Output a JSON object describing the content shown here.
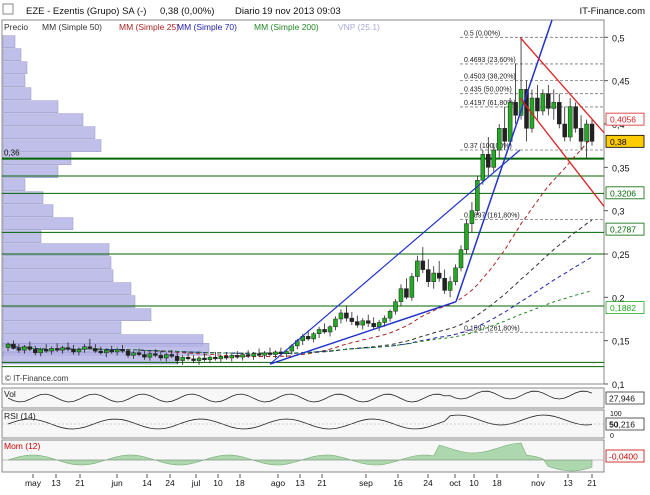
{
  "header": {
    "title": "EZE - Ezentis (Grupo) SA (-)",
    "price": "0,38 (0,00%)",
    "period": "Diario",
    "timestamp": "19 nov 2013 09:03",
    "brand": "IT-Finance.com"
  },
  "legend": [
    {
      "label": "Precio",
      "color": "#333333"
    },
    {
      "label": "MM (Simple 50)",
      "color": "#333333"
    },
    {
      "label": "MM (Simple 25)",
      "color": "#aa2222"
    },
    {
      "label": "MM (Simple 70)",
      "color": "#2222aa"
    },
    {
      "label": "MM (Simple 200)",
      "color": "#228822"
    },
    {
      "label": "VNP (25.1)",
      "color": "#aaaadd"
    }
  ],
  "copyright": "© IT-Finance.com",
  "colors": {
    "up": "#22aa22",
    "down": "#222222",
    "support": "#006600",
    "trend": "#2233cc",
    "resistance": "#dd2222",
    "fib": "#777777",
    "volume_profile": "#b4b4e6"
  },
  "chart_data": {
    "type": "candlestick",
    "ylim": [
      0.1,
      0.52
    ],
    "y_ticks": [
      {
        "value": 0.5,
        "label": "0,5"
      },
      {
        "value": 0.45,
        "label": "0,45"
      },
      {
        "value": 0.4,
        "label": "0,4"
      },
      {
        "value": 0.35,
        "label": "0,35"
      },
      {
        "value": 0.3,
        "label": "0,3"
      },
      {
        "value": 0.25,
        "label": "0,25"
      },
      {
        "value": 0.2,
        "label": "0,2"
      },
      {
        "value": 0.15,
        "label": "0,15"
      },
      {
        "value": 0.1,
        "label": "0,1"
      }
    ],
    "x_labels": [
      "may",
      "13",
      "21",
      "jun",
      "14",
      "24",
      "jul",
      "10",
      "18",
      "ago",
      "13",
      "21",
      "sep",
      "16",
      "24",
      "oct",
      "10",
      "18",
      "nov",
      "13",
      "21"
    ],
    "price_tags": [
      {
        "value": 0.4056,
        "label": "0,4056",
        "color": "#dd2222"
      },
      {
        "value": 0.38,
        "label": "0,38",
        "color": "#000000",
        "highlight": true
      },
      {
        "value": 0.3206,
        "label": "0,3206",
        "color": "#006600"
      },
      {
        "value": 0.2787,
        "label": "0,2787",
        "color": "#006600"
      },
      {
        "value": 0.1882,
        "label": "0,1882",
        "color": "#22aa22"
      }
    ],
    "support_levels": [
      0.36,
      0.34,
      0.32,
      0.275,
      0.25,
      0.19,
      0.125,
      0.12
    ],
    "left_level_label": {
      "value": 0.36,
      "label": "0,36"
    },
    "fibonacci": [
      {
        "value": 0.5,
        "label": "0.5 (0,00%)"
      },
      {
        "value": 0.4693,
        "label": "0.4693 (23,60%)"
      },
      {
        "value": 0.4503,
        "label": "0.4503 (38,20%)"
      },
      {
        "value": 0.435,
        "label": "0.435 (50,00%)"
      },
      {
        "value": 0.4197,
        "label": "0.4197 (61,80%)"
      },
      {
        "value": 0.37,
        "label": "0.37 (100,00%)"
      },
      {
        "value": 0.2897,
        "label": "0.2897 (161,80%)"
      },
      {
        "value": 0.1597,
        "label": "0.1597 (261,80%)"
      }
    ],
    "volume_profile": [
      {
        "y": 0.495,
        "w": 12
      },
      {
        "y": 0.48,
        "w": 18
      },
      {
        "y": 0.465,
        "w": 24
      },
      {
        "y": 0.45,
        "w": 22
      },
      {
        "y": 0.435,
        "w": 28
      },
      {
        "y": 0.42,
        "w": 55
      },
      {
        "y": 0.405,
        "w": 80
      },
      {
        "y": 0.39,
        "w": 92
      },
      {
        "y": 0.375,
        "w": 98
      },
      {
        "y": 0.36,
        "w": 68
      },
      {
        "y": 0.345,
        "w": 55
      },
      {
        "y": 0.33,
        "w": 22
      },
      {
        "y": 0.315,
        "w": 40
      },
      {
        "y": 0.3,
        "w": 50
      },
      {
        "y": 0.285,
        "w": 70
      },
      {
        "y": 0.27,
        "w": 38
      },
      {
        "y": 0.255,
        "w": 106
      },
      {
        "y": 0.24,
        "w": 108
      },
      {
        "y": 0.225,
        "w": 110
      },
      {
        "y": 0.21,
        "w": 128
      },
      {
        "y": 0.195,
        "w": 132
      },
      {
        "y": 0.18,
        "w": 148
      },
      {
        "y": 0.165,
        "w": 118
      },
      {
        "y": 0.15,
        "w": 200
      },
      {
        "y": 0.14,
        "w": 206
      },
      {
        "y": 0.13,
        "w": 175
      }
    ],
    "candles": [
      {
        "o": 0.142,
        "h": 0.148,
        "l": 0.138,
        "c": 0.146
      },
      {
        "o": 0.146,
        "h": 0.15,
        "l": 0.14,
        "c": 0.141
      },
      {
        "o": 0.141,
        "h": 0.146,
        "l": 0.136,
        "c": 0.139
      },
      {
        "o": 0.139,
        "h": 0.145,
        "l": 0.135,
        "c": 0.143
      },
      {
        "o": 0.143,
        "h": 0.149,
        "l": 0.138,
        "c": 0.14
      },
      {
        "o": 0.14,
        "h": 0.144,
        "l": 0.133,
        "c": 0.136
      },
      {
        "o": 0.136,
        "h": 0.142,
        "l": 0.132,
        "c": 0.14
      },
      {
        "o": 0.14,
        "h": 0.146,
        "l": 0.136,
        "c": 0.138
      },
      {
        "o": 0.138,
        "h": 0.143,
        "l": 0.134,
        "c": 0.141
      },
      {
        "o": 0.141,
        "h": 0.147,
        "l": 0.137,
        "c": 0.139
      },
      {
        "o": 0.139,
        "h": 0.144,
        "l": 0.135,
        "c": 0.142
      },
      {
        "o": 0.142,
        "h": 0.148,
        "l": 0.138,
        "c": 0.14
      },
      {
        "o": 0.14,
        "h": 0.145,
        "l": 0.134,
        "c": 0.137
      },
      {
        "o": 0.137,
        "h": 0.142,
        "l": 0.133,
        "c": 0.14
      },
      {
        "o": 0.14,
        "h": 0.146,
        "l": 0.136,
        "c": 0.143
      },
      {
        "o": 0.143,
        "h": 0.152,
        "l": 0.139,
        "c": 0.141
      },
      {
        "o": 0.141,
        "h": 0.146,
        "l": 0.136,
        "c": 0.138
      },
      {
        "o": 0.138,
        "h": 0.143,
        "l": 0.134,
        "c": 0.136
      },
      {
        "o": 0.136,
        "h": 0.141,
        "l": 0.131,
        "c": 0.139
      },
      {
        "o": 0.139,
        "h": 0.144,
        "l": 0.135,
        "c": 0.137
      },
      {
        "o": 0.137,
        "h": 0.142,
        "l": 0.133,
        "c": 0.14
      },
      {
        "o": 0.14,
        "h": 0.145,
        "l": 0.136,
        "c": 0.138
      },
      {
        "o": 0.138,
        "h": 0.14,
        "l": 0.13,
        "c": 0.133
      },
      {
        "o": 0.133,
        "h": 0.138,
        "l": 0.129,
        "c": 0.136
      },
      {
        "o": 0.136,
        "h": 0.141,
        "l": 0.132,
        "c": 0.134
      },
      {
        "o": 0.134,
        "h": 0.139,
        "l": 0.128,
        "c": 0.131
      },
      {
        "o": 0.131,
        "h": 0.137,
        "l": 0.127,
        "c": 0.135
      },
      {
        "o": 0.135,
        "h": 0.14,
        "l": 0.131,
        "c": 0.133
      },
      {
        "o": 0.133,
        "h": 0.138,
        "l": 0.127,
        "c": 0.13
      },
      {
        "o": 0.13,
        "h": 0.136,
        "l": 0.126,
        "c": 0.134
      },
      {
        "o": 0.134,
        "h": 0.139,
        "l": 0.13,
        "c": 0.132
      },
      {
        "o": 0.132,
        "h": 0.136,
        "l": 0.123,
        "c": 0.127
      },
      {
        "o": 0.127,
        "h": 0.133,
        "l": 0.122,
        "c": 0.131
      },
      {
        "o": 0.131,
        "h": 0.136,
        "l": 0.127,
        "c": 0.129
      },
      {
        "o": 0.129,
        "h": 0.133,
        "l": 0.124,
        "c": 0.127
      },
      {
        "o": 0.127,
        "h": 0.132,
        "l": 0.122,
        "c": 0.13
      },
      {
        "o": 0.13,
        "h": 0.135,
        "l": 0.126,
        "c": 0.128
      },
      {
        "o": 0.128,
        "h": 0.133,
        "l": 0.124,
        "c": 0.131
      },
      {
        "o": 0.131,
        "h": 0.137,
        "l": 0.127,
        "c": 0.129
      },
      {
        "o": 0.129,
        "h": 0.134,
        "l": 0.125,
        "c": 0.132
      },
      {
        "o": 0.132,
        "h": 0.137,
        "l": 0.128,
        "c": 0.13
      },
      {
        "o": 0.13,
        "h": 0.135,
        "l": 0.126,
        "c": 0.133
      },
      {
        "o": 0.133,
        "h": 0.138,
        "l": 0.129,
        "c": 0.131
      },
      {
        "o": 0.131,
        "h": 0.136,
        "l": 0.127,
        "c": 0.134
      },
      {
        "o": 0.134,
        "h": 0.139,
        "l": 0.13,
        "c": 0.132
      },
      {
        "o": 0.132,
        "h": 0.137,
        "l": 0.128,
        "c": 0.135
      },
      {
        "o": 0.135,
        "h": 0.141,
        "l": 0.131,
        "c": 0.133
      },
      {
        "o": 0.133,
        "h": 0.138,
        "l": 0.129,
        "c": 0.136
      },
      {
        "o": 0.136,
        "h": 0.142,
        "l": 0.132,
        "c": 0.134
      },
      {
        "o": 0.134,
        "h": 0.139,
        "l": 0.13,
        "c": 0.137
      },
      {
        "o": 0.137,
        "h": 0.142,
        "l": 0.133,
        "c": 0.135
      },
      {
        "o": 0.135,
        "h": 0.14,
        "l": 0.131,
        "c": 0.138
      },
      {
        "o": 0.138,
        "h": 0.146,
        "l": 0.134,
        "c": 0.144
      },
      {
        "o": 0.144,
        "h": 0.152,
        "l": 0.14,
        "c": 0.15
      },
      {
        "o": 0.15,
        "h": 0.158,
        "l": 0.145,
        "c": 0.155
      },
      {
        "o": 0.155,
        "h": 0.162,
        "l": 0.15,
        "c": 0.152
      },
      {
        "o": 0.152,
        "h": 0.16,
        "l": 0.148,
        "c": 0.158
      },
      {
        "o": 0.158,
        "h": 0.166,
        "l": 0.153,
        "c": 0.163
      },
      {
        "o": 0.163,
        "h": 0.17,
        "l": 0.158,
        "c": 0.16
      },
      {
        "o": 0.16,
        "h": 0.168,
        "l": 0.155,
        "c": 0.166
      },
      {
        "o": 0.166,
        "h": 0.178,
        "l": 0.162,
        "c": 0.175
      },
      {
        "o": 0.175,
        "h": 0.186,
        "l": 0.17,
        "c": 0.182
      },
      {
        "o": 0.182,
        "h": 0.19,
        "l": 0.172,
        "c": 0.176
      },
      {
        "o": 0.176,
        "h": 0.183,
        "l": 0.168,
        "c": 0.172
      },
      {
        "o": 0.172,
        "h": 0.179,
        "l": 0.165,
        "c": 0.168
      },
      {
        "o": 0.168,
        "h": 0.176,
        "l": 0.163,
        "c": 0.173
      },
      {
        "o": 0.173,
        "h": 0.18,
        "l": 0.166,
        "c": 0.17
      },
      {
        "o": 0.17,
        "h": 0.177,
        "l": 0.163,
        "c": 0.166
      },
      {
        "o": 0.166,
        "h": 0.174,
        "l": 0.161,
        "c": 0.171
      },
      {
        "o": 0.171,
        "h": 0.179,
        "l": 0.166,
        "c": 0.176
      },
      {
        "o": 0.176,
        "h": 0.186,
        "l": 0.172,
        "c": 0.184
      },
      {
        "o": 0.184,
        "h": 0.198,
        "l": 0.18,
        "c": 0.195
      },
      {
        "o": 0.195,
        "h": 0.215,
        "l": 0.19,
        "c": 0.21
      },
      {
        "o": 0.21,
        "h": 0.222,
        "l": 0.198,
        "c": 0.2
      },
      {
        "o": 0.2,
        "h": 0.228,
        "l": 0.196,
        "c": 0.224
      },
      {
        "o": 0.224,
        "h": 0.248,
        "l": 0.218,
        "c": 0.242
      },
      {
        "o": 0.242,
        "h": 0.258,
        "l": 0.228,
        "c": 0.232
      },
      {
        "o": 0.232,
        "h": 0.244,
        "l": 0.212,
        "c": 0.218
      },
      {
        "o": 0.218,
        "h": 0.236,
        "l": 0.21,
        "c": 0.228
      },
      {
        "o": 0.228,
        "h": 0.242,
        "l": 0.218,
        "c": 0.222
      },
      {
        "o": 0.222,
        "h": 0.232,
        "l": 0.204,
        "c": 0.208
      },
      {
        "o": 0.208,
        "h": 0.224,
        "l": 0.2,
        "c": 0.218
      },
      {
        "o": 0.218,
        "h": 0.238,
        "l": 0.214,
        "c": 0.234
      },
      {
        "o": 0.234,
        "h": 0.26,
        "l": 0.23,
        "c": 0.255
      },
      {
        "o": 0.255,
        "h": 0.29,
        "l": 0.25,
        "c": 0.285
      },
      {
        "o": 0.285,
        "h": 0.31,
        "l": 0.275,
        "c": 0.3
      },
      {
        "o": 0.3,
        "h": 0.34,
        "l": 0.295,
        "c": 0.335
      },
      {
        "o": 0.335,
        "h": 0.37,
        "l": 0.33,
        "c": 0.365
      },
      {
        "o": 0.365,
        "h": 0.385,
        "l": 0.34,
        "c": 0.35
      },
      {
        "o": 0.35,
        "h": 0.378,
        "l": 0.345,
        "c": 0.37
      },
      {
        "o": 0.37,
        "h": 0.4,
        "l": 0.36,
        "c": 0.395
      },
      {
        "o": 0.395,
        "h": 0.42,
        "l": 0.37,
        "c": 0.38
      },
      {
        "o": 0.38,
        "h": 0.43,
        "l": 0.375,
        "c": 0.425
      },
      {
        "o": 0.425,
        "h": 0.47,
        "l": 0.4,
        "c": 0.41
      },
      {
        "o": 0.41,
        "h": 0.5,
        "l": 0.405,
        "c": 0.44
      },
      {
        "o": 0.44,
        "h": 0.45,
        "l": 0.38,
        "c": 0.395
      },
      {
        "o": 0.395,
        "h": 0.44,
        "l": 0.39,
        "c": 0.43
      },
      {
        "o": 0.43,
        "h": 0.445,
        "l": 0.405,
        "c": 0.415
      },
      {
        "o": 0.415,
        "h": 0.44,
        "l": 0.41,
        "c": 0.435
      },
      {
        "o": 0.435,
        "h": 0.445,
        "l": 0.41,
        "c": 0.418
      },
      {
        "o": 0.418,
        "h": 0.44,
        "l": 0.405,
        "c": 0.425
      },
      {
        "o": 0.425,
        "h": 0.435,
        "l": 0.395,
        "c": 0.4
      },
      {
        "o": 0.4,
        "h": 0.42,
        "l": 0.38,
        "c": 0.385
      },
      {
        "o": 0.385,
        "h": 0.43,
        "l": 0.38,
        "c": 0.42
      },
      {
        "o": 0.42,
        "h": 0.425,
        "l": 0.39,
        "c": 0.395
      },
      {
        "o": 0.395,
        "h": 0.41,
        "l": 0.37,
        "c": 0.38
      },
      {
        "o": 0.38,
        "h": 0.405,
        "l": 0.36,
        "c": 0.4
      },
      {
        "o": 0.4,
        "h": 0.405,
        "l": 0.375,
        "c": 0.38
      }
    ],
    "panels": {
      "volume": {
        "label": "Vol",
        "value_label": "27,946"
      },
      "rsi": {
        "label": "RSI (14)",
        "ticks": [
          "100",
          "50",
          "0"
        ],
        "value_label": "50,216"
      },
      "mom": {
        "label": "Mom (12)",
        "value_label": "-0,0400"
      }
    }
  }
}
